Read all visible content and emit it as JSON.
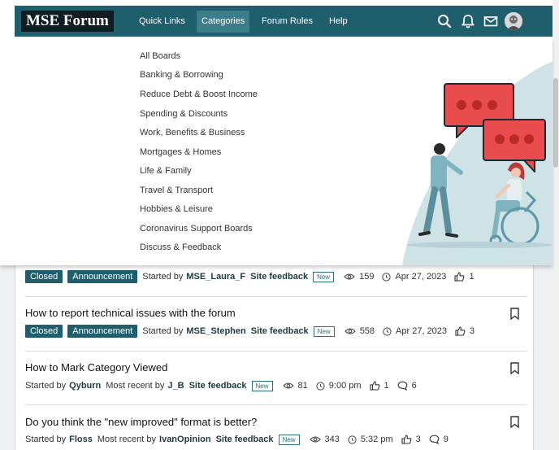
{
  "header": {
    "logo": "MSE Forum",
    "nav": [
      "Quick Links",
      "Categories",
      "Forum Rules",
      "Help"
    ],
    "active_nav": "Categories"
  },
  "dropdown": {
    "categories": [
      "All Boards",
      "Banking & Borrowing",
      "Reduce Debt & Boost Income",
      "Spending & Discounts",
      "Work, Benefits & Business",
      "Mortgages & Homes",
      "Life & Family",
      "Travel & Transport",
      "Hobbies & Leisure",
      "Coronavirus Support Boards",
      "Discuss & Feedback"
    ],
    "illustration_colors": {
      "bubble": "#e84c4c",
      "backdrop": "#cfe2e6",
      "teal": "#5a9aa8"
    }
  },
  "topics": [
    {
      "title": "",
      "badges": [
        "Closed",
        "Announcement"
      ],
      "started_label": "Started by",
      "author": "MSE_Laura_F",
      "board": "Site feedback",
      "new_label": "New",
      "views": "159",
      "time": "Apr 27, 2023",
      "likes": "1"
    },
    {
      "title": "How to report technical issues with the forum",
      "badges": [
        "Closed",
        "Announcement"
      ],
      "started_label": "Started by",
      "author": "MSE_Stephen",
      "board": "Site feedback",
      "new_label": "New",
      "views": "558",
      "time": "Apr 27, 2023",
      "likes": "3"
    },
    {
      "title": "How to Mark Category Viewed",
      "started_label": "Started by",
      "author": "Qyburn",
      "recent_label": "Most recent by",
      "recent_author": "J_B",
      "board": "Site feedback",
      "new_label": "New",
      "views": "81",
      "time": "9:00 pm",
      "likes": "1",
      "comments": "6"
    },
    {
      "title": "Do you think the \"new improved\" format is better?",
      "started_label": "Started by",
      "author": "Floss",
      "recent_label": "Most recent by",
      "recent_author": "IvanOpinion",
      "board": "Site feedback",
      "new_label": "New",
      "views": "343",
      "time": "5:32 pm",
      "likes": "3",
      "comments": "9"
    }
  ],
  "colors": {
    "brand": "#1f5f6d",
    "logo_bg": "#0f1c21",
    "active_nav": "#3c7d8c"
  }
}
